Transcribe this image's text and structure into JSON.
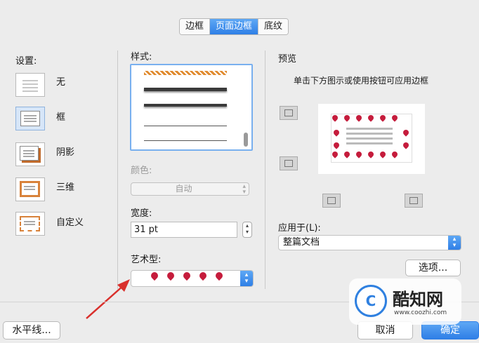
{
  "tabs": [
    {
      "label": "边框",
      "active": false
    },
    {
      "label": "页面边框",
      "active": true
    },
    {
      "label": "底纹",
      "active": false
    }
  ],
  "settings": {
    "title": "设置:",
    "items": [
      {
        "label": "无",
        "selected": false
      },
      {
        "label": "框",
        "selected": true
      },
      {
        "label": "阴影",
        "selected": false
      },
      {
        "label": "三维",
        "selected": false
      },
      {
        "label": "自定义",
        "selected": false
      }
    ]
  },
  "style": {
    "title": "样式:"
  },
  "color": {
    "label": "颜色:",
    "value": "自动"
  },
  "width": {
    "label": "宽度:",
    "value": "31 pt"
  },
  "art": {
    "label": "艺术型:"
  },
  "preview": {
    "title": "预览",
    "hint": "单击下方图示或使用按钮可应用边框"
  },
  "apply_to": {
    "label": "应用于(L):",
    "value": "整篇文档"
  },
  "buttons": {
    "options": "选项...",
    "horizontal_line": "水平线...",
    "cancel": "取消",
    "ok": "确定"
  },
  "watermark": {
    "name": "酷知网",
    "url": "www.coozhi.com"
  },
  "colors": {
    "accent": "#2f7fe6",
    "heart": "#c51c3c",
    "arrow": "#d9302c"
  }
}
